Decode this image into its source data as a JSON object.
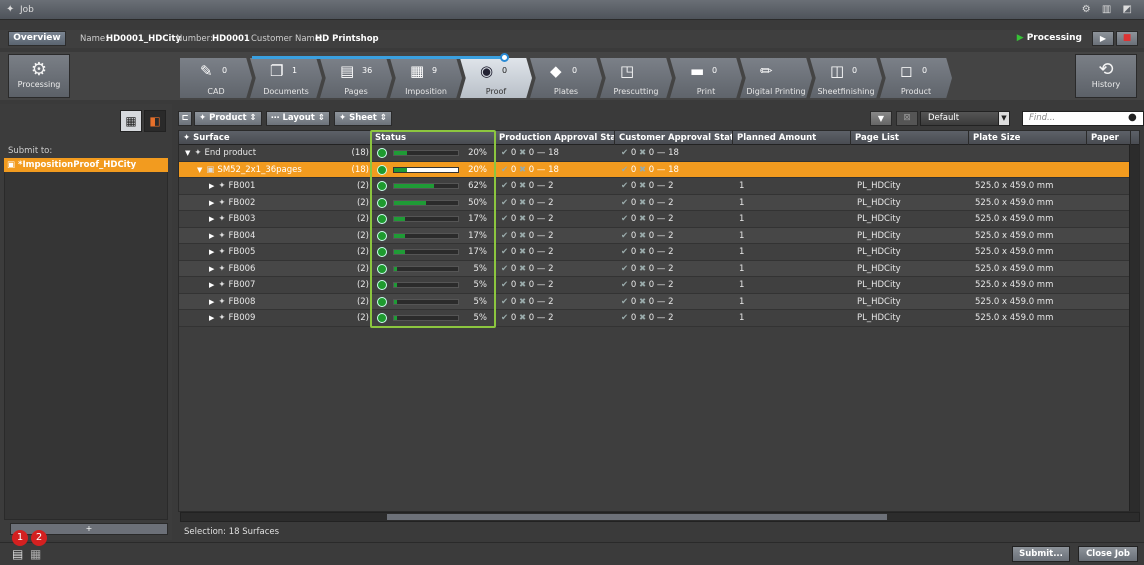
{
  "window": {
    "title": "Job"
  },
  "infobar": {
    "overview": "Overview",
    "name_label": "Name:",
    "name_value": "HD0001_HDCity",
    "number_label": "Number:",
    "number_value": "HD0001",
    "customer_label": "Customer Name:",
    "customer_value": "HD Printshop",
    "processing": "Processing"
  },
  "workflow": {
    "left_tile": "Processing",
    "right_tile": "History",
    "steps": [
      {
        "label": "CAD",
        "count": "0"
      },
      {
        "label": "Documents",
        "count": "1"
      },
      {
        "label": "Pages",
        "count": "36"
      },
      {
        "label": "Imposition",
        "count": "9"
      },
      {
        "label": "Proof",
        "count": "0"
      },
      {
        "label": "Plates",
        "count": "0"
      },
      {
        "label": "Prescutting",
        "count": ""
      },
      {
        "label": "Print",
        "count": "0"
      },
      {
        "label": "Digital Printing",
        "count": ""
      },
      {
        "label": "Sheetfinishing",
        "count": "0"
      },
      {
        "label": "Product",
        "count": "0"
      }
    ]
  },
  "leftpanel": {
    "submit_to": "Submit to:",
    "item": "*ImpositionProof_HDCity",
    "add_btn": "+"
  },
  "toolbar": {
    "product": "Product",
    "layout": "Layout",
    "sheet": "Sheet",
    "view_select": "Default",
    "find_placeholder": "Find..."
  },
  "table": {
    "headers": [
      "Surface",
      "Status",
      "Production Approval Status",
      "Customer Approval Status",
      "Planned Amount",
      "Page List",
      "Plate Size",
      "Paper"
    ],
    "rows": [
      {
        "name": "End product",
        "count": "(18)",
        "pct": "20%",
        "fill": 0.2,
        "pa": "0",
        "px": "0",
        "pd": "18",
        "ca": "0",
        "cx": "0",
        "cd": "18",
        "planned": "",
        "pagelist": "",
        "plate": ""
      },
      {
        "name": "SM52_2x1_36pages",
        "count": "(18)",
        "pct": "20%",
        "fill": 0.2,
        "pa": "0",
        "px": "0",
        "pd": "18",
        "ca": "0",
        "cx": "0",
        "cd": "18",
        "planned": "",
        "pagelist": "",
        "plate": ""
      },
      {
        "name": "FB001",
        "count": "(2)",
        "pct": "62%",
        "fill": 0.62,
        "pa": "0",
        "px": "0",
        "pd": "2",
        "ca": "0",
        "cx": "0",
        "cd": "2",
        "planned": "1",
        "pagelist": "PL_HDCity",
        "plate": "525.0 x 459.0 mm"
      },
      {
        "name": "FB002",
        "count": "(2)",
        "pct": "50%",
        "fill": 0.5,
        "pa": "0",
        "px": "0",
        "pd": "2",
        "ca": "0",
        "cx": "0",
        "cd": "2",
        "planned": "1",
        "pagelist": "PL_HDCity",
        "plate": "525.0 x 459.0 mm"
      },
      {
        "name": "FB003",
        "count": "(2)",
        "pct": "17%",
        "fill": 0.17,
        "pa": "0",
        "px": "0",
        "pd": "2",
        "ca": "0",
        "cx": "0",
        "cd": "2",
        "planned": "1",
        "pagelist": "PL_HDCity",
        "plate": "525.0 x 459.0 mm"
      },
      {
        "name": "FB004",
        "count": "(2)",
        "pct": "17%",
        "fill": 0.17,
        "pa": "0",
        "px": "0",
        "pd": "2",
        "ca": "0",
        "cx": "0",
        "cd": "2",
        "planned": "1",
        "pagelist": "PL_HDCity",
        "plate": "525.0 x 459.0 mm"
      },
      {
        "name": "FB005",
        "count": "(2)",
        "pct": "17%",
        "fill": 0.17,
        "pa": "0",
        "px": "0",
        "pd": "2",
        "ca": "0",
        "cx": "0",
        "cd": "2",
        "planned": "1",
        "pagelist": "PL_HDCity",
        "plate": "525.0 x 459.0 mm"
      },
      {
        "name": "FB006",
        "count": "(2)",
        "pct": "5%",
        "fill": 0.05,
        "pa": "0",
        "px": "0",
        "pd": "2",
        "ca": "0",
        "cx": "0",
        "cd": "2",
        "planned": "1",
        "pagelist": "PL_HDCity",
        "plate": "525.0 x 459.0 mm"
      },
      {
        "name": "FB007",
        "count": "(2)",
        "pct": "5%",
        "fill": 0.05,
        "pa": "0",
        "px": "0",
        "pd": "2",
        "ca": "0",
        "cx": "0",
        "cd": "2",
        "planned": "1",
        "pagelist": "PL_HDCity",
        "plate": "525.0 x 459.0 mm"
      },
      {
        "name": "FB008",
        "count": "(2)",
        "pct": "5%",
        "fill": 0.05,
        "pa": "0",
        "px": "0",
        "pd": "2",
        "ca": "0",
        "cx": "0",
        "cd": "2",
        "planned": "1",
        "pagelist": "PL_HDCity",
        "plate": "525.0 x 459.0 mm"
      },
      {
        "name": "FB009",
        "count": "(2)",
        "pct": "5%",
        "fill": 0.05,
        "pa": "0",
        "px": "0",
        "pd": "2",
        "ca": "0",
        "cx": "0",
        "cd": "2",
        "planned": "1",
        "pagelist": "PL_HDCity",
        "plate": "525.0 x 459.0 mm"
      }
    ]
  },
  "status": {
    "selection": "Selection: 18 Surfaces"
  },
  "bottom": {
    "submit": "Submit...",
    "close": "Close Job",
    "badge1": "1",
    "badge2": "2"
  },
  "colors": {
    "accent": "#f29b1f",
    "ok": "#1f9b36",
    "highlight": "#8cc63f",
    "badge": "#d42020"
  }
}
